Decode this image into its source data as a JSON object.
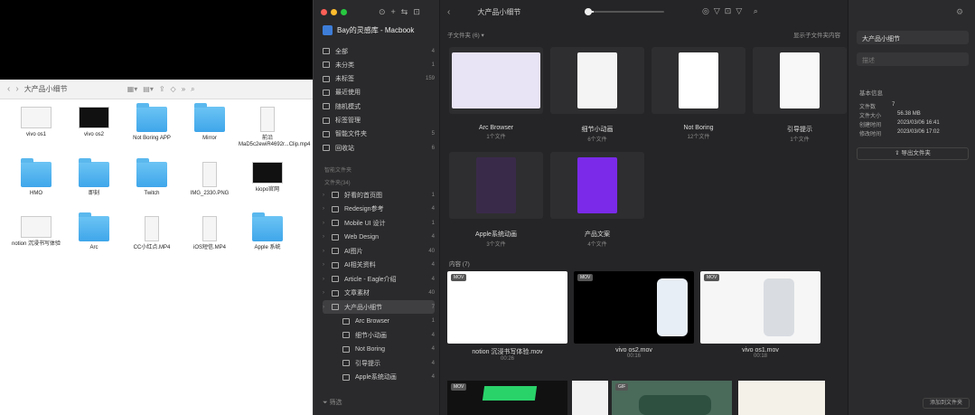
{
  "finder": {
    "title": "大产品小细节",
    "nav_back": "‹",
    "nav_forward": "›",
    "items": [
      {
        "label": "vivo os1",
        "kind": "video"
      },
      {
        "label": "vivo os2",
        "kind": "video-dark"
      },
      {
        "label": "Not Boring APP",
        "kind": "folder"
      },
      {
        "label": "Mirror",
        "kind": "folder"
      },
      {
        "label": "前沿MaD5c2ewiR4692r...Clip.mp4",
        "kind": "video-tall"
      },
      {
        "label": "HMO",
        "kind": "folder"
      },
      {
        "label": "即刻",
        "kind": "folder"
      },
      {
        "label": "Twitch",
        "kind": "folder"
      },
      {
        "label": "IMG_2330.PNG",
        "kind": "video-tall"
      },
      {
        "label": "kiopo官网",
        "kind": "video-dark"
      },
      {
        "label": "notion 沉浸书写体验",
        "kind": "video"
      },
      {
        "label": "Arc",
        "kind": "folder"
      },
      {
        "label": "CC小红点.MP4",
        "kind": "video-tall"
      },
      {
        "label": "iOS短信.MP4",
        "kind": "video-tall"
      },
      {
        "label": "Apple 系统",
        "kind": "folder"
      }
    ]
  },
  "eagle": {
    "library": "Bay的灵感库 - Macbook",
    "sidebar": {
      "items": [
        {
          "label": "全部",
          "count": "4"
        },
        {
          "label": "未分类",
          "count": "1"
        },
        {
          "label": "未标签",
          "count": "159"
        },
        {
          "label": "最近使用",
          "count": ""
        },
        {
          "label": "随机模式",
          "count": ""
        },
        {
          "label": "标签管理",
          "count": ""
        },
        {
          "label": "智能文件夹",
          "count": "5"
        },
        {
          "label": "回收站",
          "count": "6"
        }
      ],
      "section_heading": "智能文件夹",
      "folders_heading": "文件夹(34)",
      "folders": [
        {
          "label": "好看的首页图",
          "count": "1"
        },
        {
          "label": "Redesign参考",
          "count": "4"
        },
        {
          "label": "Mobile UI 设计",
          "count": "1"
        },
        {
          "label": "Web Design",
          "count": "4"
        },
        {
          "label": "AI图片",
          "count": "40"
        },
        {
          "label": "AI相关资料",
          "count": "4"
        },
        {
          "label": "Article - Eagle介绍",
          "count": "4"
        },
        {
          "label": "文章素材",
          "count": "40"
        },
        {
          "label": "大产品小细节",
          "count": "7",
          "selected": true
        },
        {
          "label": "Arc Browser",
          "count": "1",
          "sub": true
        },
        {
          "label": "细节小动画",
          "count": "4",
          "sub": true
        },
        {
          "label": "Not Boring",
          "count": "4",
          "sub": true
        },
        {
          "label": "引导提示",
          "count": "4",
          "sub": true
        },
        {
          "label": "Apple系统动画",
          "count": "4",
          "sub": true
        }
      ],
      "filter_placeholder": "筛选"
    },
    "main": {
      "title": "大产品小细节",
      "subfolder_label": "子文件夹 (6) ▾",
      "show_sub_content": "显示子文件夹内容",
      "folders": [
        {
          "name": "Arc Browser",
          "count": "1个文件"
        },
        {
          "name": "细节小动画",
          "count": "6个文件"
        },
        {
          "name": "Not Boring",
          "count": "12个文件"
        },
        {
          "name": "引导提示",
          "count": "1个文件"
        },
        {
          "name": "Apple系统动画",
          "count": "3个文件"
        },
        {
          "name": "产品文案",
          "count": "4个文件"
        }
      ],
      "content_label": "内容 (7)",
      "videos": [
        {
          "name": "notion 沉浸书写体验.mov",
          "duration": "00:26",
          "badge": "MOV"
        },
        {
          "name": "vivo os2.mov",
          "duration": "00:16",
          "badge": "MOV"
        },
        {
          "name": "vivo os1.mov",
          "duration": "00:18",
          "badge": "MOV"
        }
      ],
      "bottom_badges": [
        "MOV",
        "GIF"
      ]
    },
    "inspector": {
      "name": "大产品小细节",
      "notes_placeholder": "描述",
      "basic_info": "基本信息",
      "rows": [
        {
          "k": "文件数",
          "v": "7"
        },
        {
          "k": "文件大小",
          "v": "56.38 MB"
        },
        {
          "k": "创建时间",
          "v": "2023/03/06 16:41"
        },
        {
          "k": "修改时间",
          "v": "2023/03/06 17:02"
        }
      ],
      "export_label": "导出文件夹",
      "add_button": "添加到文件夹"
    }
  }
}
